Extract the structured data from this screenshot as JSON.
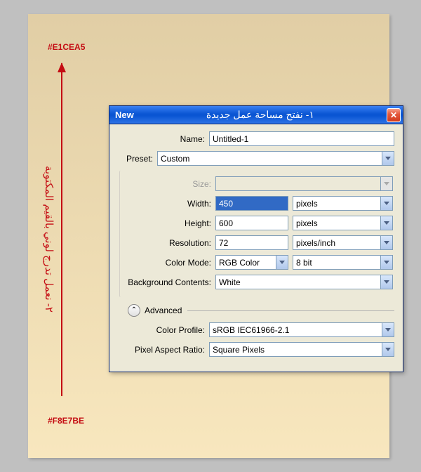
{
  "background": {
    "hex_top": "#E1CEA5",
    "hex_bottom": "#F8E7BE",
    "vertical_text": "٢- نعمل تدرج لوني بالقيم المكتوبة"
  },
  "dialog": {
    "title_left": "New",
    "title_center": "١- نفتح مساحة عمل جديدة",
    "name_label": "Name:",
    "name_value": "Untitled-1",
    "preset_label": "Preset:",
    "preset_value": "Custom",
    "size_label": "Size:",
    "size_value": "",
    "width_label": "Width:",
    "width_value": "450",
    "width_unit": "pixels",
    "height_label": "Height:",
    "height_value": "600",
    "height_unit": "pixels",
    "resolution_label": "Resolution:",
    "resolution_value": "72",
    "resolution_unit": "pixels/inch",
    "colormode_label": "Color Mode:",
    "colormode_value": "RGB Color",
    "colormode_depth": "8 bit",
    "bgcontents_label": "Background Contents:",
    "bgcontents_value": "White",
    "advanced_label": "Advanced",
    "colorprofile_label": "Color Profile:",
    "colorprofile_value": "sRGB IEC61966-2.1",
    "pixelar_label": "Pixel Aspect Ratio:",
    "pixelar_value": "Square Pixels"
  }
}
